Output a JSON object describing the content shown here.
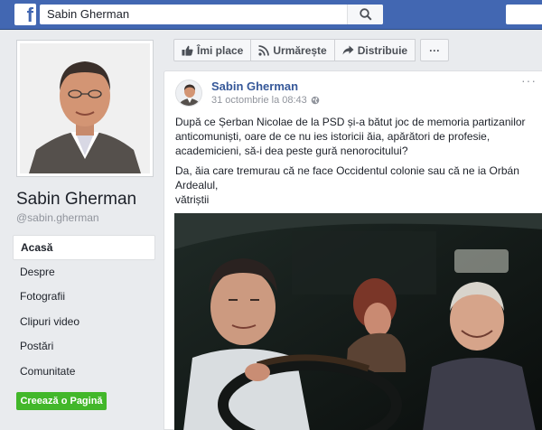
{
  "topbar": {
    "logo": "f",
    "search_value": "Sabin Gherman",
    "search_icon": "search-icon"
  },
  "profile": {
    "name": "Sabin Gherman",
    "handle": "@sabin.gherman"
  },
  "nav": {
    "items": [
      {
        "label": "Acasă",
        "active": true
      },
      {
        "label": "Despre"
      },
      {
        "label": "Fotografii"
      },
      {
        "label": "Clipuri video"
      },
      {
        "label": "Postări"
      },
      {
        "label": "Comunitate"
      }
    ],
    "create_page": "Creează o Pagină"
  },
  "actions": {
    "like": "Îmi place",
    "follow": "Urmărește",
    "share": "Distribuie",
    "more": "···"
  },
  "post": {
    "author": "Sabin Gherman",
    "time": "31 octombrie la 08:43",
    "privacy_icon": "globe-icon",
    "menu": "···",
    "paragraph_1": "După ce Șerban Nicolae de la PSD și-a bătut joc de memoria partizanilor anticomuniști, oare de ce nu ies istoricii ăia, apărători de profesie, academicieni, să-i dea peste gură nenorocitului?",
    "paragraph_2_line_1": "Da, ăia care tremurau că ne face Occidentul colonie sau că ne ia Orbán Ardealul,",
    "paragraph_2_line_2": "vătriștii"
  },
  "colors": {
    "brand": "#4267b2",
    "link": "#365899",
    "create_button": "#42b72a",
    "background": "#e9ebee"
  }
}
